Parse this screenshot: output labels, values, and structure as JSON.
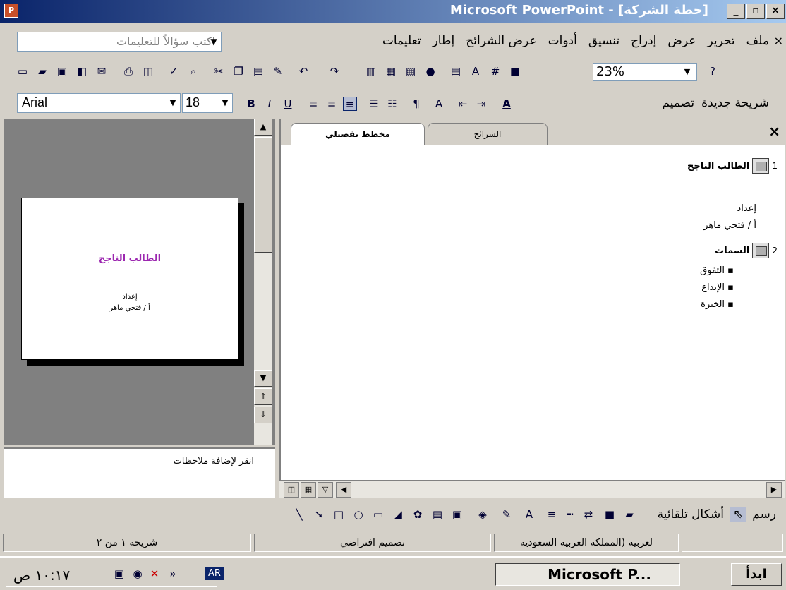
{
  "window": {
    "title": "Microsoft PowerPoint - [حطة الشركة]",
    "app_icon": "P",
    "buttons": [
      "_",
      "▫",
      "×"
    ]
  },
  "menu": {
    "items": [
      "ملف",
      "تحرير",
      "عرض",
      "إدراج",
      "تنسيق",
      "أدوات",
      "عرض الشرائح",
      "إطار",
      "تعليمات"
    ],
    "help_placeholder": "اكتب سؤالاً للتعليمات",
    "close": "×"
  },
  "toolbar_standard": {
    "zoom": "23%"
  },
  "toolbar_format": {
    "font": "Arial",
    "size": "18",
    "design_label": "تصميم",
    "new_slide_label": "شريحة جديدة"
  },
  "slide_preview": {
    "title": "الطالب الناجح",
    "line1": "إعداد",
    "line2": "أ / فتحي ماهر"
  },
  "notes": {
    "placeholder": "انقر لإضافة ملاحظات"
  },
  "outline_pane": {
    "tabs": [
      "مخطط تفصيلي",
      "الشرائح"
    ],
    "close": "×",
    "slides": [
      {
        "num": "1",
        "title": "الطالب الناجح",
        "lines": [
          "إعداد",
          "أ / فتحي ماهر"
        ]
      },
      {
        "num": "2",
        "title": "السمات",
        "bullets": [
          "التفوق",
          "الإبداع",
          "الخبرة"
        ]
      }
    ]
  },
  "drawing_toolbar": {
    "draw_label": "رسم",
    "autoshapes_label": "أشكال تلقائية"
  },
  "status": {
    "slide": "شريحة ١ من ٢",
    "design": "تصميم افتراضي",
    "language": "لعربية (المملكة العربية السعودية"
  },
  "taskbar": {
    "start": "ابدأ",
    "app": "Microsoft P...",
    "clock": "١٠:١٧ ص",
    "lang": "AR"
  }
}
